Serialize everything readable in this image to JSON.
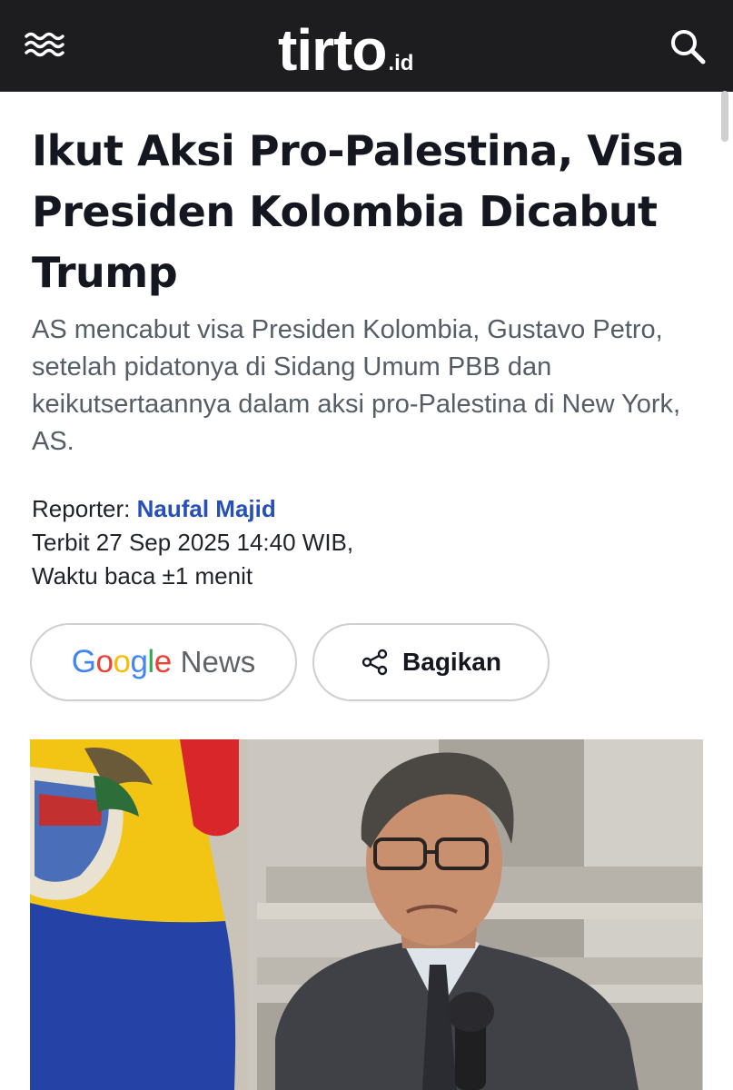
{
  "header": {
    "logo_text": "tirto",
    "logo_suffix": ".id",
    "menu_icon": "menu-waves-icon",
    "search_icon": "search-icon",
    "background_color": "#1d1d1f"
  },
  "article": {
    "title": "Ikut Aksi Pro-Palestina, Visa Presiden Kolombia Dicabut Trump",
    "lede": "AS mencabut visa Presiden Kolombia, Gustavo Petro, setelah pidatonya di Sidang Umum PBB dan keikutsertaannya dalam aksi pro-Palestina di New York, AS.",
    "reporter_label": "Reporter:",
    "reporter_name": "Naufal Majid",
    "published": "Terbit 27 Sep 2025 14:40 WIB,",
    "read_time": "Waktu baca ±1 menit"
  },
  "buttons": {
    "google_letters": [
      "G",
      "o",
      "o",
      "g",
      "l",
      "e"
    ],
    "google_news_suffix": "News",
    "share_label": "Bagikan",
    "share_icon": "share-icon"
  },
  "colors": {
    "title": "#14171f",
    "reporter_link": "#2650b5",
    "google_blue": "#4285F4",
    "google_red": "#EA4335",
    "google_yellow": "#FBBC05",
    "google_green": "#34A853"
  }
}
